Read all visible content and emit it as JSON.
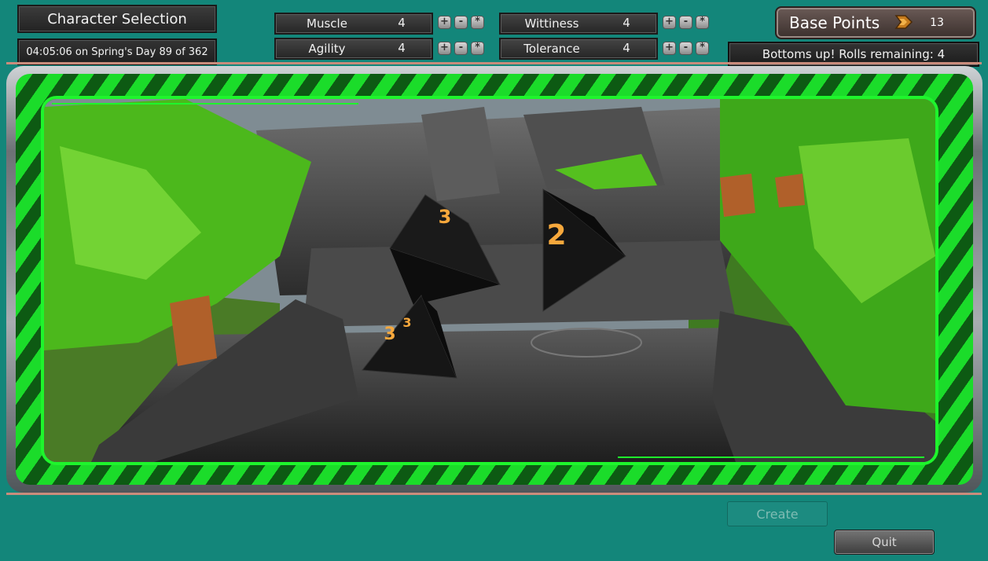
{
  "header": {
    "title": "Character Selection",
    "datetime": "04:05:06 on Spring's Day 89 of 362"
  },
  "stats": [
    {
      "label": "Muscle",
      "value": "4"
    },
    {
      "label": "Agility",
      "value": "4"
    },
    {
      "label": "Wittiness",
      "value": "4"
    },
    {
      "label": "Tolerance",
      "value": "4"
    }
  ],
  "stat_buttons": {
    "plus": "+",
    "minus": "-",
    "random": "*"
  },
  "base_points": {
    "label": "Base Points",
    "value": "13"
  },
  "rolls": "Bottoms up! Rolls remaining: 4",
  "dice": [
    "3",
    "2",
    "3",
    "3"
  ],
  "actions": {
    "create": "Create",
    "quit": "Quit"
  },
  "colors": {
    "accent": "#1ef52c",
    "background": "#13867a"
  }
}
